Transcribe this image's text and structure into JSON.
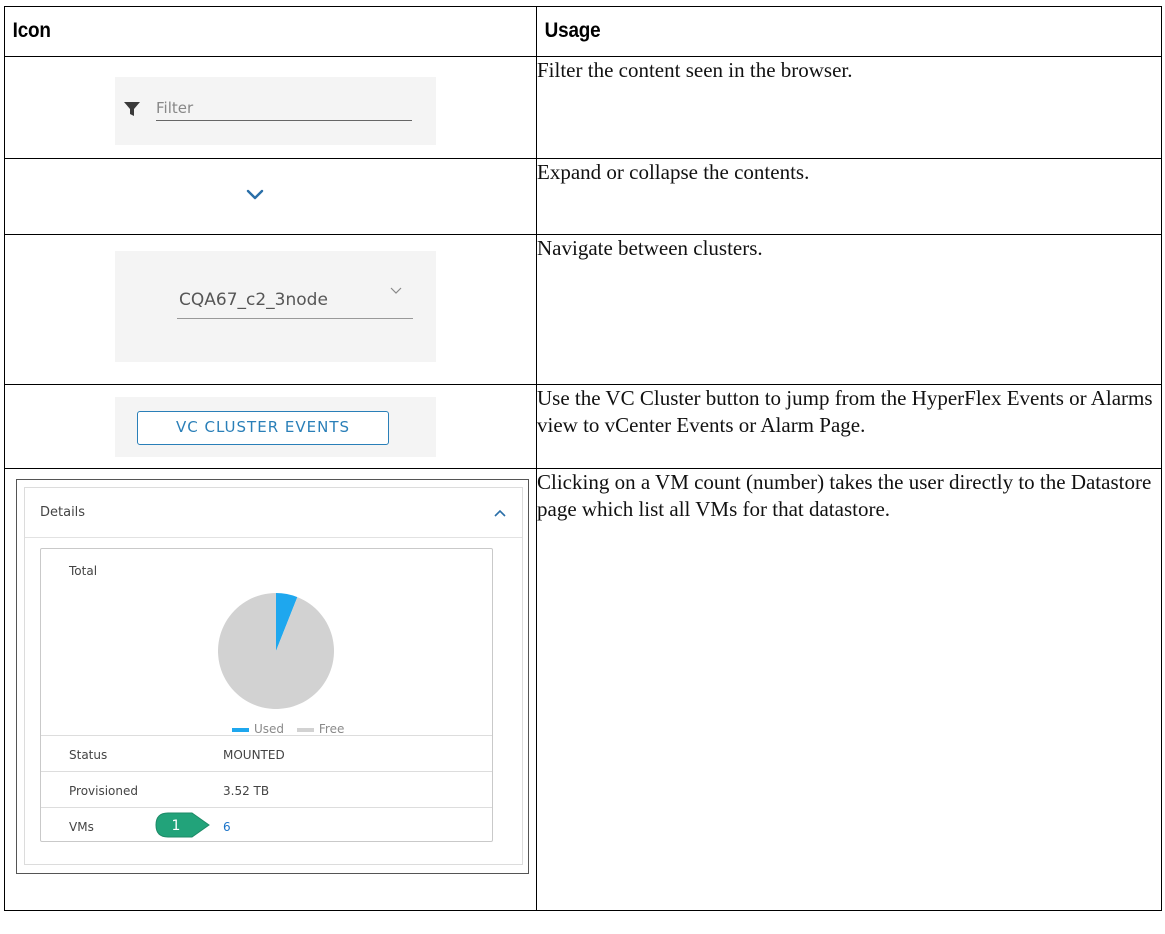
{
  "headers": {
    "icon": "Icon",
    "usage": "Usage"
  },
  "rows": [
    {
      "usage": "Filter the content seen in the browser."
    },
    {
      "usage": "Expand or collapse the contents."
    },
    {
      "usage": "Navigate between clusters."
    },
    {
      "usage": "Use the VC Cluster button to jump from the HyperFlex Events or Alarms view to vCenter Events or Alarm Page."
    },
    {
      "usage": "Clicking on a VM count (number) takes the user directly to the Datastore page which list all VMs for that datastore."
    }
  ],
  "filter": {
    "placeholder": "Filter",
    "icon": "filter-funnel-icon"
  },
  "expand": {
    "icon": "chevron-down-icon"
  },
  "cluster": {
    "value": "CQA67_c2_3node",
    "icon": "chevron-down-icon"
  },
  "vc_button": {
    "label": "VC CLUSTER EVENTS"
  },
  "details": {
    "title": "Details",
    "total_label": "Total",
    "legend": {
      "used": "Used",
      "free": "Free"
    },
    "status_label": "Status",
    "status_value": "MOUNTED",
    "provisioned_label": "Provisioned",
    "provisioned_value": "3.52 TB",
    "vms_label": "VMs",
    "vms_value": "6",
    "callout": "1"
  },
  "colors": {
    "used": "#1ea7ee",
    "free": "#d2d2d2",
    "link": "#1a73c8",
    "button": "#2a7fb8",
    "callout": "#22a37a"
  },
  "chart_data": {
    "type": "pie",
    "categories": [
      "Used",
      "Free"
    ],
    "values": [
      6,
      94
    ]
  }
}
